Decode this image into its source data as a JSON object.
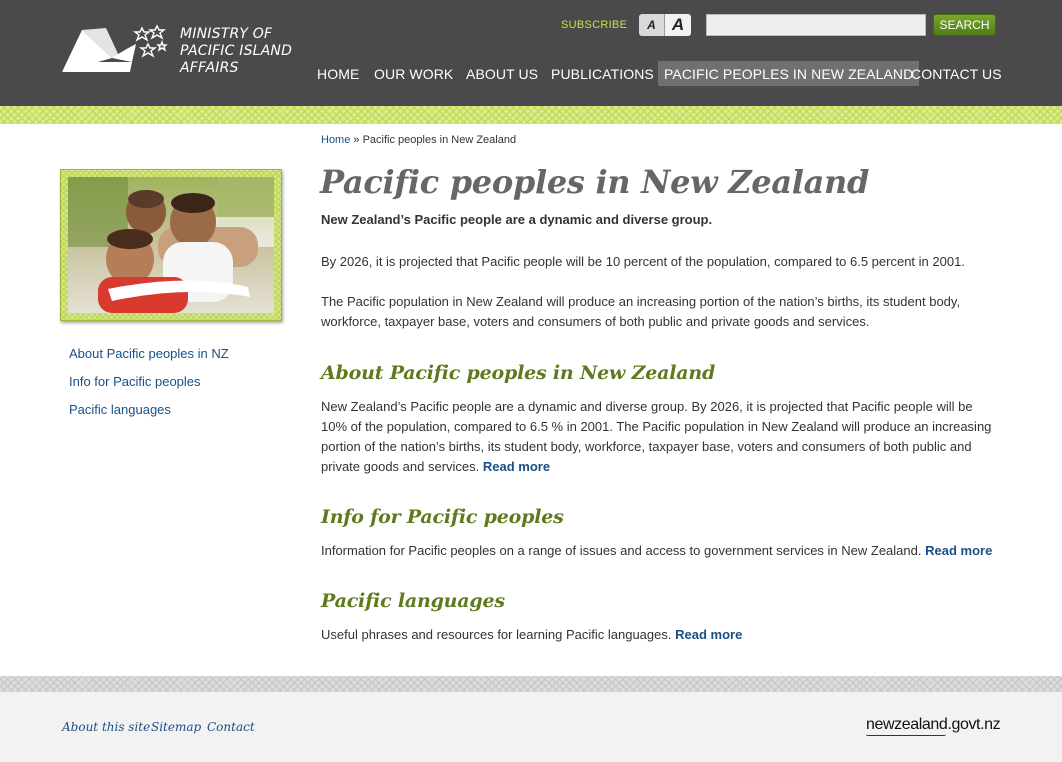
{
  "header": {
    "logo_lines": [
      "MINISTRY OF",
      "PACIFIC ISLAND",
      "AFFAIRS"
    ],
    "subscribe": "SUBSCRIBE",
    "textsize_small": "A",
    "textsize_large": "A",
    "search_value": "",
    "search_button": "SEARCH",
    "nav": [
      "HOME",
      "OUR WORK",
      "ABOUT US",
      "PUBLICATIONS",
      "PACIFIC PEOPLES IN NEW ZEALAND",
      "CONTACT US"
    ],
    "active_nav": "PACIFIC PEOPLES IN NEW ZEALAND"
  },
  "sidebar": {
    "links": [
      "About Pacific peoples in NZ",
      "Info for Pacific peoples",
      "Pacific languages"
    ]
  },
  "main": {
    "breadcrumb_home": "Home",
    "breadcrumb_sep": "»",
    "breadcrumb_current": "Pacific peoples in New Zealand",
    "title": "Pacific peoples in New Zealand",
    "lead": "New Zealand’s Pacific people are a dynamic and diverse group.",
    "para1": "By 2026, it is projected that Pacific people will be 10 percent of the population, compared to 6.5 percent in 2001.",
    "para2": "The Pacific population in New Zealand will produce an increasing portion of the nation’s births, its student body, workforce, taxpayer base, voters and consumers of both public and private goods and services.",
    "sections": [
      {
        "heading": "About Pacific peoples in New Zealand",
        "text": "New Zealand’s Pacific people are a dynamic and diverse group. By 2026, it is projected that Pacific people will be 10% of the population, compared to 6.5 % in 2001. The Pacific population in New Zealand will produce an increasing portion of the nation’s births, its student body, workforce, taxpayer base, voters and consumers of both public and private goods and services.",
        "read_more": "Read more"
      },
      {
        "heading": "Info for Pacific peoples",
        "text": "Information for Pacific peoples on a range of issues and access to government services in New Zealand.",
        "read_more": "Read more"
      },
      {
        "heading": "Pacific languages",
        "text": "Useful phrases and resources for learning Pacific languages.",
        "read_more": "Read more"
      }
    ]
  },
  "footer": {
    "links": [
      "About this site",
      "Sitemap",
      "Contact"
    ],
    "govt_logo": "newzealand.govt.nz"
  },
  "colors": {
    "header_bg": "#4a4a4c",
    "accent_green": "#5e7a1d",
    "link_blue": "#1a4f86",
    "subscribe_yellow": "#c8e04a"
  }
}
